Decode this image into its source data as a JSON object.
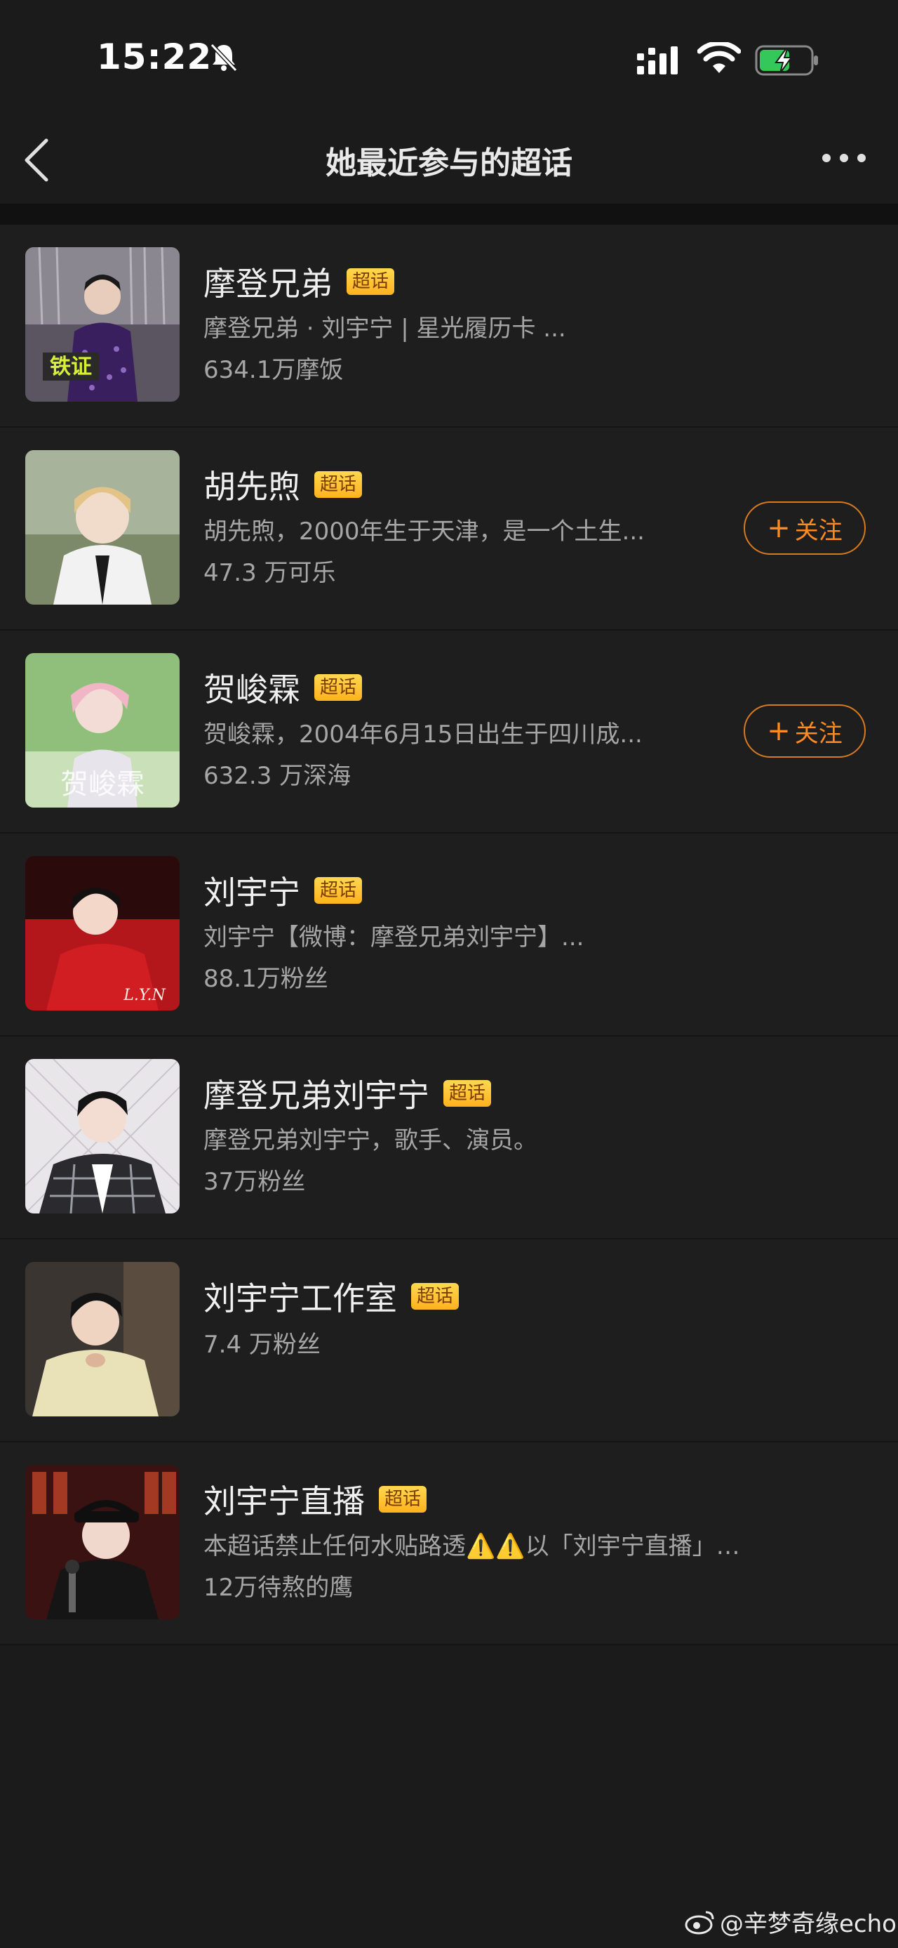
{
  "status_bar": {
    "time": "15:22"
  },
  "header": {
    "title": "她最近参与的超话"
  },
  "badge_label": "超话",
  "items": [
    {
      "name": "摩登兄弟",
      "desc": "摩登兄弟 · 刘宇宁 | 星光履历卡 ...",
      "fans": "634.1万摩饭",
      "follow": ""
    },
    {
      "name": "胡先煦",
      "desc": "胡先煦，2000年生于天津，是一个土生...",
      "fans": "47.3 万可乐",
      "follow": "关注"
    },
    {
      "name": "贺峻霖",
      "desc": "贺峻霖，2004年6月15日出生于四川成...",
      "fans": "632.3 万深海",
      "follow": "关注"
    },
    {
      "name": "刘宇宁",
      "desc": "刘宇宁【微博：摩登兄弟刘宇宁】...",
      "fans": "88.1万粉丝",
      "follow": ""
    },
    {
      "name": "摩登兄弟刘宇宁",
      "desc": "摩登兄弟刘宇宁，歌手、演员。",
      "fans": "37万粉丝",
      "follow": ""
    },
    {
      "name": "刘宇宁工作室",
      "desc": "",
      "fans": "7.4 万粉丝",
      "follow": ""
    },
    {
      "name": "刘宇宁直播",
      "desc": "本超话禁止任何水贴路透⚠️⚠️以「刘宇宁直播」👈🏻...",
      "fans": "12万待熬的鹰",
      "follow": ""
    }
  ],
  "thumbs": {
    "t1_text": "铁证",
    "t3_text": "贺峻霖",
    "t4_text": "L.Y.N"
  },
  "watermark": "@辛梦奇缘echo"
}
